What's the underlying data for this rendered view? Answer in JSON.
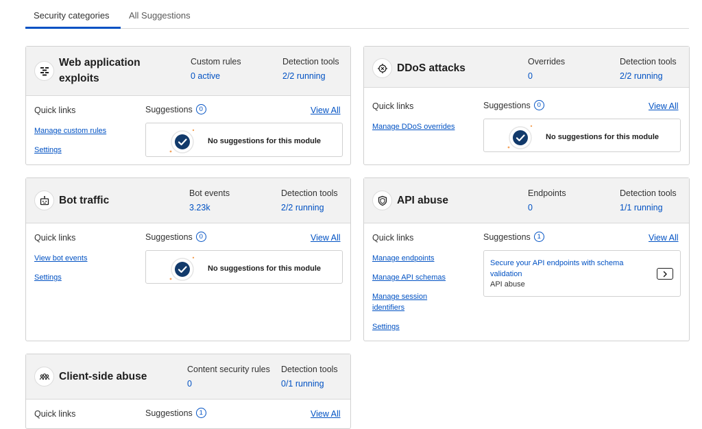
{
  "tabs": [
    {
      "label": "Security categories",
      "active": true
    },
    {
      "label": "All Suggestions",
      "active": false
    }
  ],
  "colors": {
    "accent": "#0051c3",
    "header_bg": "#f2f2f2",
    "border": "#d0d0d0",
    "highlight": "#f4a35c"
  },
  "empty_text": "No suggestions for this module",
  "cards": {
    "web": {
      "icon": "firewall-icon",
      "title": "Web application exploits",
      "stat1": {
        "label": "Custom rules",
        "value": "0 active"
      },
      "stat2": {
        "label": "Detection tools",
        "value": "2/2 running"
      },
      "quick_links_label": "Quick links",
      "links": [
        "Manage custom rules",
        "Settings"
      ],
      "suggestions_label": "Suggestions",
      "suggestions_count": "0",
      "view_all": "View All"
    },
    "ddos": {
      "icon": "ddos-target-icon",
      "title": "DDoS attacks",
      "stat1": {
        "label": "Overrides",
        "value": "0"
      },
      "stat2": {
        "label": "Detection tools",
        "value": "2/2 running"
      },
      "quick_links_label": "Quick links",
      "links": [
        "Manage DDoS overrides"
      ],
      "suggestions_label": "Suggestions",
      "suggestions_count": "0",
      "view_all": "View All"
    },
    "bot": {
      "icon": "robot-icon",
      "title": "Bot traffic",
      "stat1": {
        "label": "Bot events",
        "value": "3.23k"
      },
      "stat2": {
        "label": "Detection tools",
        "value": "2/2 running"
      },
      "quick_links_label": "Quick links",
      "links": [
        "View bot events",
        "Settings"
      ],
      "suggestions_label": "Suggestions",
      "suggestions_count": "0",
      "view_all": "View All"
    },
    "api": {
      "icon": "shield-icon",
      "title": "API abuse",
      "stat1": {
        "label": "Endpoints",
        "value": "0"
      },
      "stat2": {
        "label": "Detection tools",
        "value": "1/1 running"
      },
      "quick_links_label": "Quick links",
      "links": [
        "Manage endpoints",
        "Manage API schemas",
        "Manage session identifiers",
        "Settings"
      ],
      "suggestions_label": "Suggestions",
      "suggestions_count": "1",
      "view_all": "View All",
      "suggestion_item": {
        "title": "Secure your API endpoints with schema validation",
        "subtitle": "API abuse"
      }
    },
    "client": {
      "icon": "users-icon",
      "title": "Client-side abuse",
      "stat1": {
        "label": "Content security rules",
        "value": "0"
      },
      "stat2": {
        "label": "Detection tools",
        "value": "0/1 running"
      },
      "quick_links_label": "Quick links",
      "suggestions_label": "Suggestions",
      "suggestions_count": "1",
      "view_all": "View All"
    }
  }
}
